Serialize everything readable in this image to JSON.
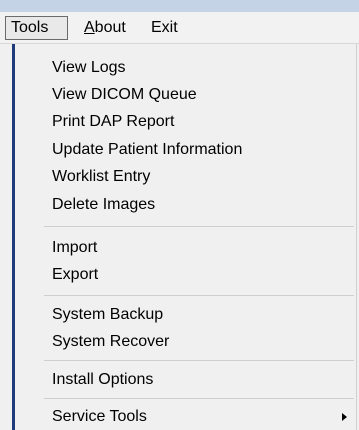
{
  "menubar": {
    "tools": "Tools",
    "about_first": "A",
    "about_rest": "bout",
    "exit": "Exit"
  },
  "menu": {
    "group1": [
      "View Logs",
      "View DICOM Queue",
      "Print DAP Report",
      "Update Patient Information",
      "Worklist Entry",
      "Delete Images"
    ],
    "group2": [
      "Import",
      "Export"
    ],
    "group3": [
      "System Backup",
      "System Recover"
    ],
    "group4": [
      "Install Options"
    ],
    "group5": [
      "Service Tools"
    ]
  },
  "icons": {
    "submenu_arrow": "triangle-right"
  }
}
